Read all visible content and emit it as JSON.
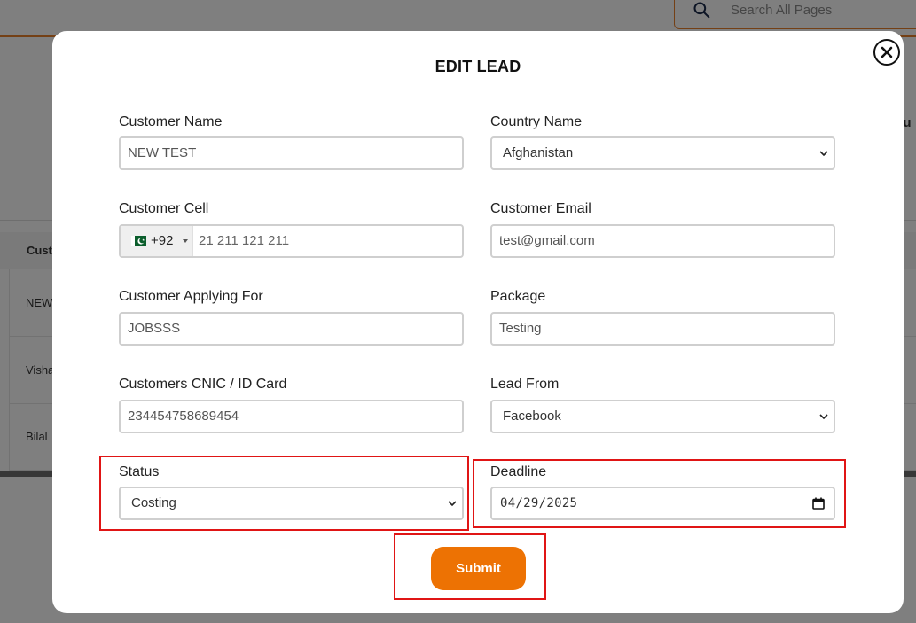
{
  "background": {
    "search_placeholder": "Search All Pages",
    "table_header_first": "Cust",
    "right_header_fragment": "olu",
    "rows": [
      "NEW",
      "Visha",
      "Bilal"
    ]
  },
  "modal": {
    "title": "EDIT LEAD",
    "fields": {
      "customer_name": {
        "label": "Customer Name",
        "value": "NEW TEST"
      },
      "country_name": {
        "label": "Country Name",
        "value": "Afghanistan"
      },
      "customer_cell": {
        "label": "Customer Cell",
        "dial_code": "+92",
        "value": "21 211 121 211"
      },
      "customer_email": {
        "label": "Customer Email",
        "value": "test@gmail.com"
      },
      "applying_for": {
        "label": "Customer Applying For",
        "value": "JOBSSS"
      },
      "package": {
        "label": "Package",
        "value": "Testing"
      },
      "cnic": {
        "label": "Customers CNIC / ID Card",
        "value": "234454758689454"
      },
      "lead_from": {
        "label": "Lead From",
        "value": "Facebook"
      },
      "status": {
        "label": "Status",
        "value": "Costing"
      },
      "deadline": {
        "label": "Deadline",
        "value": "04/29/2025"
      }
    },
    "submit_label": "Submit"
  },
  "colors": {
    "accent": "#ed7203",
    "highlight": "#e01515",
    "flag_green": "#0b5e2c"
  },
  "icons": {
    "close": "close-icon",
    "search": "search-icon",
    "calendar": "calendar-icon",
    "flag": "pakistan-flag-icon"
  }
}
